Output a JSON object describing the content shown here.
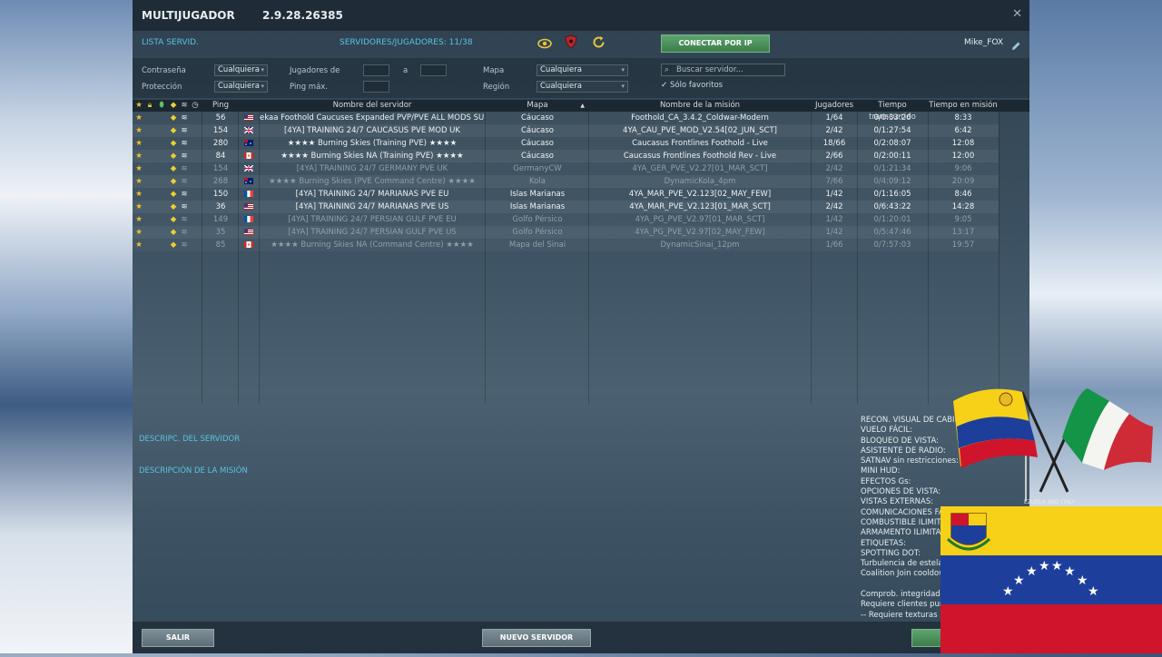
{
  "header": {
    "title": "MULTIJUGADOR",
    "version": "2.9.28.26385",
    "user": "Mike_FOX"
  },
  "toolbar": {
    "server_list": "LISTA SERVID.",
    "servers_players": "SERVIDORES/JUGADORES: 11/38",
    "connect_ip": "CONECTAR POR IP"
  },
  "filters": {
    "password_label": "Contraseña",
    "password_value": "Cualquiera",
    "protection_label": "Protección",
    "protection_value": "Cualquiera",
    "players_label": "Jugadores de",
    "to_label": "a",
    "ping_label": "Ping máx.",
    "map_label": "Mapa",
    "map_value": "Cualquiera",
    "region_label": "Región",
    "region_value": "Cualquiera",
    "search_placeholder": "Buscar servidor...",
    "favorites_label": "Sólo favoritos"
  },
  "columns": {
    "ping": "Ping",
    "name": "Nombre del servidor",
    "map": "Mapa",
    "mission": "Nombre de la misión",
    "players": "Jugadores",
    "elapsed": "Tiempo transcurrido",
    "mission_time": "Tiempo en misión"
  },
  "servers": [
    {
      "ping": "56",
      "flag": "us",
      "name": "ekaa Foothold Caucuses Expanded PVP/PVE ALL MODS SUPPORT",
      "map": "Cáucaso",
      "mission": "Foothold_CA_3.4.2_Coldwar-Modern",
      "players": "1/64",
      "elapsed": "0/0:33:26",
      "mtime": "8:33",
      "active": true
    },
    {
      "ping": "154",
      "flag": "uk",
      "name": "[4YA] TRAINING 24/7 CAUCASUS PVE MOD UK",
      "map": "Cáucaso",
      "mission": "4YA_CAU_PVE_MOD_V2.54[02_JUN_SCT]",
      "players": "2/42",
      "elapsed": "0/1:27:54",
      "mtime": "6:42",
      "active": true
    },
    {
      "ping": "280",
      "flag": "au",
      "name": "★★★★ Burning Skies (Training PVE) ★★★★",
      "map": "Cáucaso",
      "mission": "Caucasus Frontlines Foothold - Live",
      "players": "18/66",
      "elapsed": "0/2:08:07",
      "mtime": "12:08",
      "active": true
    },
    {
      "ping": "84",
      "flag": "ca",
      "name": "★★★★ Burning Skies NA (Training PVE) ★★★★",
      "map": "Cáucaso",
      "mission": "Caucasus Frontlines Foothold Rev - Live",
      "players": "2/66",
      "elapsed": "0/2:00:11",
      "mtime": "12:00",
      "active": true
    },
    {
      "ping": "154",
      "flag": "uk",
      "name": "[4YA] TRAINING 24/7 GERMANY PVE UK",
      "map": "GermanyCW",
      "mission": "4YA_GER_PVE_V2.27[01_MAR_SCT]",
      "players": "2/42",
      "elapsed": "0/1:21:34",
      "mtime": "9:06",
      "active": false
    },
    {
      "ping": "268",
      "flag": "au",
      "name": "★★★★ Burning Skies (PVE Command Centre) ★★★★",
      "map": "Kola",
      "mission": "DynamicKola_4pm",
      "players": "7/66",
      "elapsed": "0/4:09:12",
      "mtime": "20:09",
      "active": false
    },
    {
      "ping": "150",
      "flag": "fr",
      "name": "[4YA] TRAINING 24/7 MARIANAS PVE EU",
      "map": "Islas Marianas",
      "mission": "4YA_MAR_PVE_V2.123[02_MAY_FEW]",
      "players": "1/42",
      "elapsed": "0/1:16:05",
      "mtime": "8:46",
      "active": true
    },
    {
      "ping": "36",
      "flag": "us",
      "name": "[4YA] TRAINING 24/7 MARIANAS PVE US",
      "map": "Islas Marianas",
      "mission": "4YA_MAR_PVE_V2.123[01_MAR_SCT]",
      "players": "2/42",
      "elapsed": "0/6:43:22",
      "mtime": "14:28",
      "active": true
    },
    {
      "ping": "149",
      "flag": "fr",
      "name": "[4YA] TRAINING 24/7 PERSIAN GULF PVE EU",
      "map": "Golfo Pérsico",
      "mission": "4YA_PG_PVE_V2.97[01_MAR_SCT]",
      "players": "1/42",
      "elapsed": "0/1:20:01",
      "mtime": "9:05",
      "active": false
    },
    {
      "ping": "35",
      "flag": "us",
      "name": "[4YA] TRAINING 24/7 PERSIAN GULF PVE US",
      "map": "Golfo Pérsico",
      "mission": "4YA_PG_PVE_V2.97[02_MAY_FEW]",
      "players": "1/42",
      "elapsed": "0/5:47:46",
      "mtime": "13:17",
      "active": false
    },
    {
      "ping": "85",
      "flag": "ca",
      "name": "★★★★ Burning Skies NA (Command Centre) ★★★★",
      "map": "Mapa del Sinai",
      "mission": "DynamicSinai_12pm",
      "players": "1/66",
      "elapsed": "0/7:57:03",
      "mtime": "19:57",
      "active": false
    }
  ],
  "details": {
    "server_desc": "DESCRIPC. DEL SERVIDOR",
    "mission_desc": "DESCRIPCIÓN DE LA MISIÓN"
  },
  "rules": [
    "RECON. VISUAL DE CABIN",
    "VUELO FÁCIL:",
    "BLOQUEO DE VISTA:",
    "ASISTENTE DE RADIO:",
    "SATNAV sin restricciones:",
    "MINI HUD:",
    "EFECTOS Gs:",
    "OPCIONES DE VISTA:",
    "VISTAS EXTERNAS:",
    "COMUNICACIONES FÁC",
    "COMBUSTIBLE ILIMITAD",
    "ARMAMENTO ILIMITAD",
    "ETIQUETAS:",
    "SPOTTING DOT:",
    "Turbulencia de estela:",
    "Coalition Join cooldown",
    "",
    "Comprob. integridad",
    "Requiere clientes puros",
    "-- Requiere texturas pu"
  ],
  "footer": {
    "exit": "SALIR",
    "new_server": "NUEVO SERVIDOR"
  },
  "overlay": {
    "caption": "EZUELA AND ITALY"
  },
  "colors": {
    "accent": "#59c3e0",
    "button_green": "#4a9159",
    "star": "#f2c130"
  }
}
